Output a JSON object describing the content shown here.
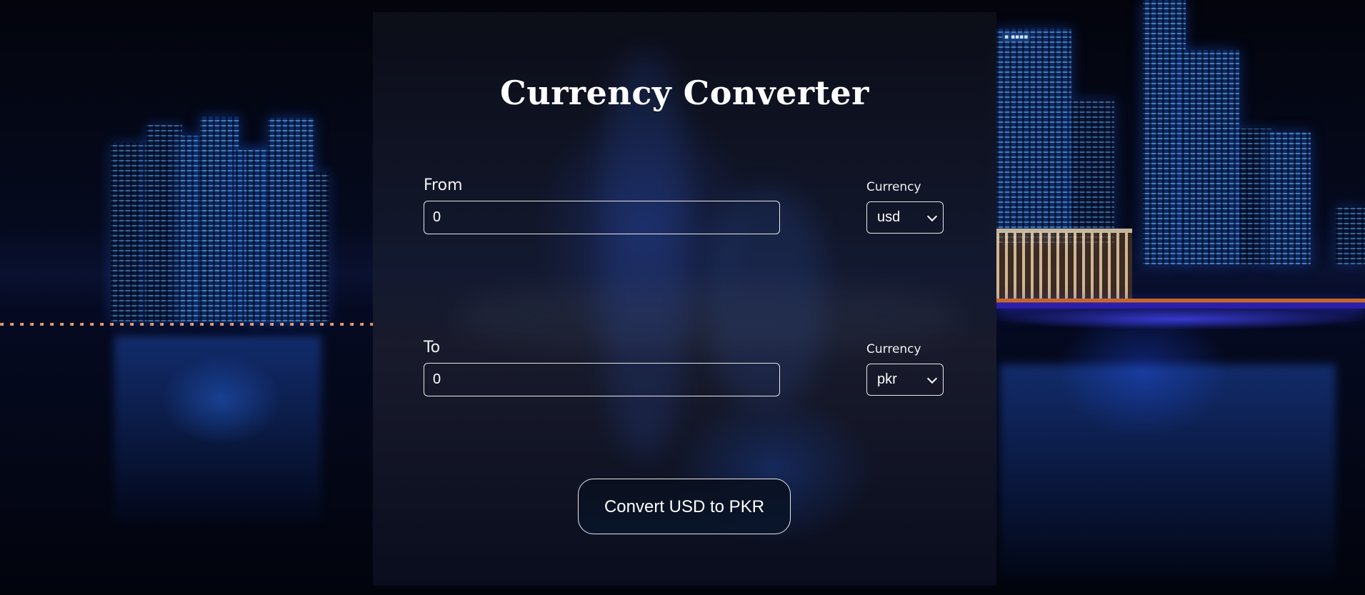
{
  "page": {
    "title": "Currency Converter"
  },
  "from": {
    "label": "From",
    "value": "0",
    "currency_label": "Currency",
    "currency": "usd"
  },
  "to": {
    "label": "To",
    "value": "0",
    "currency_label": "Currency",
    "currency": "pkr"
  },
  "convert_button": {
    "label": "Convert USD to PKR"
  },
  "icons": {
    "select_arrow": "chevron-down-icon"
  },
  "colors": {
    "background": "#050a1e",
    "panel": "#12182c",
    "text": "#ffffff",
    "border": "#e8e8e8",
    "city_glow": "#2a5bd6"
  }
}
